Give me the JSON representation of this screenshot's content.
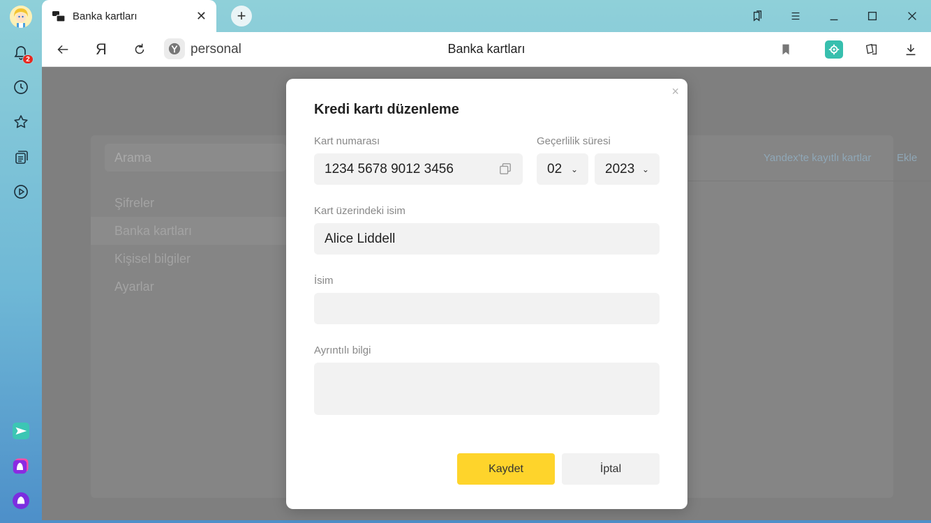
{
  "sidebar": {
    "notification_count": "2"
  },
  "tab": {
    "title": "Banka kartları"
  },
  "toolbar": {
    "yandex_letter": "Я",
    "address": "personal",
    "page_title": "Banka kartları"
  },
  "page": {
    "search_placeholder": "Arama",
    "menu": [
      {
        "label": "Şifreler"
      },
      {
        "label": "Banka kartları"
      },
      {
        "label": "Kişisel bilgiler"
      },
      {
        "label": "Ayarlar"
      }
    ],
    "link_saved_cards": "Yandex'te kayıtlı kartlar",
    "link_add": "Ekle"
  },
  "modal": {
    "title": "Kredi kartı düzenleme",
    "card_number_label": "Kart numarası",
    "card_number_value": "1234 5678 9012 3456",
    "expiry_label": "Geçerlilik süresi",
    "expiry_month": "02",
    "expiry_year": "2023",
    "cardholder_label": "Kart üzerindeki isim",
    "cardholder_value": "Alice Liddell",
    "name_label": "İsim",
    "name_value": "",
    "details_label": "Ayrıntılı bilgi",
    "details_value": "",
    "save_label": "Kaydet",
    "cancel_label": "İptal",
    "close_glyph": "×"
  },
  "colors": {
    "accent_yellow": "#fed42b",
    "overlay": "#7f7f7f"
  }
}
